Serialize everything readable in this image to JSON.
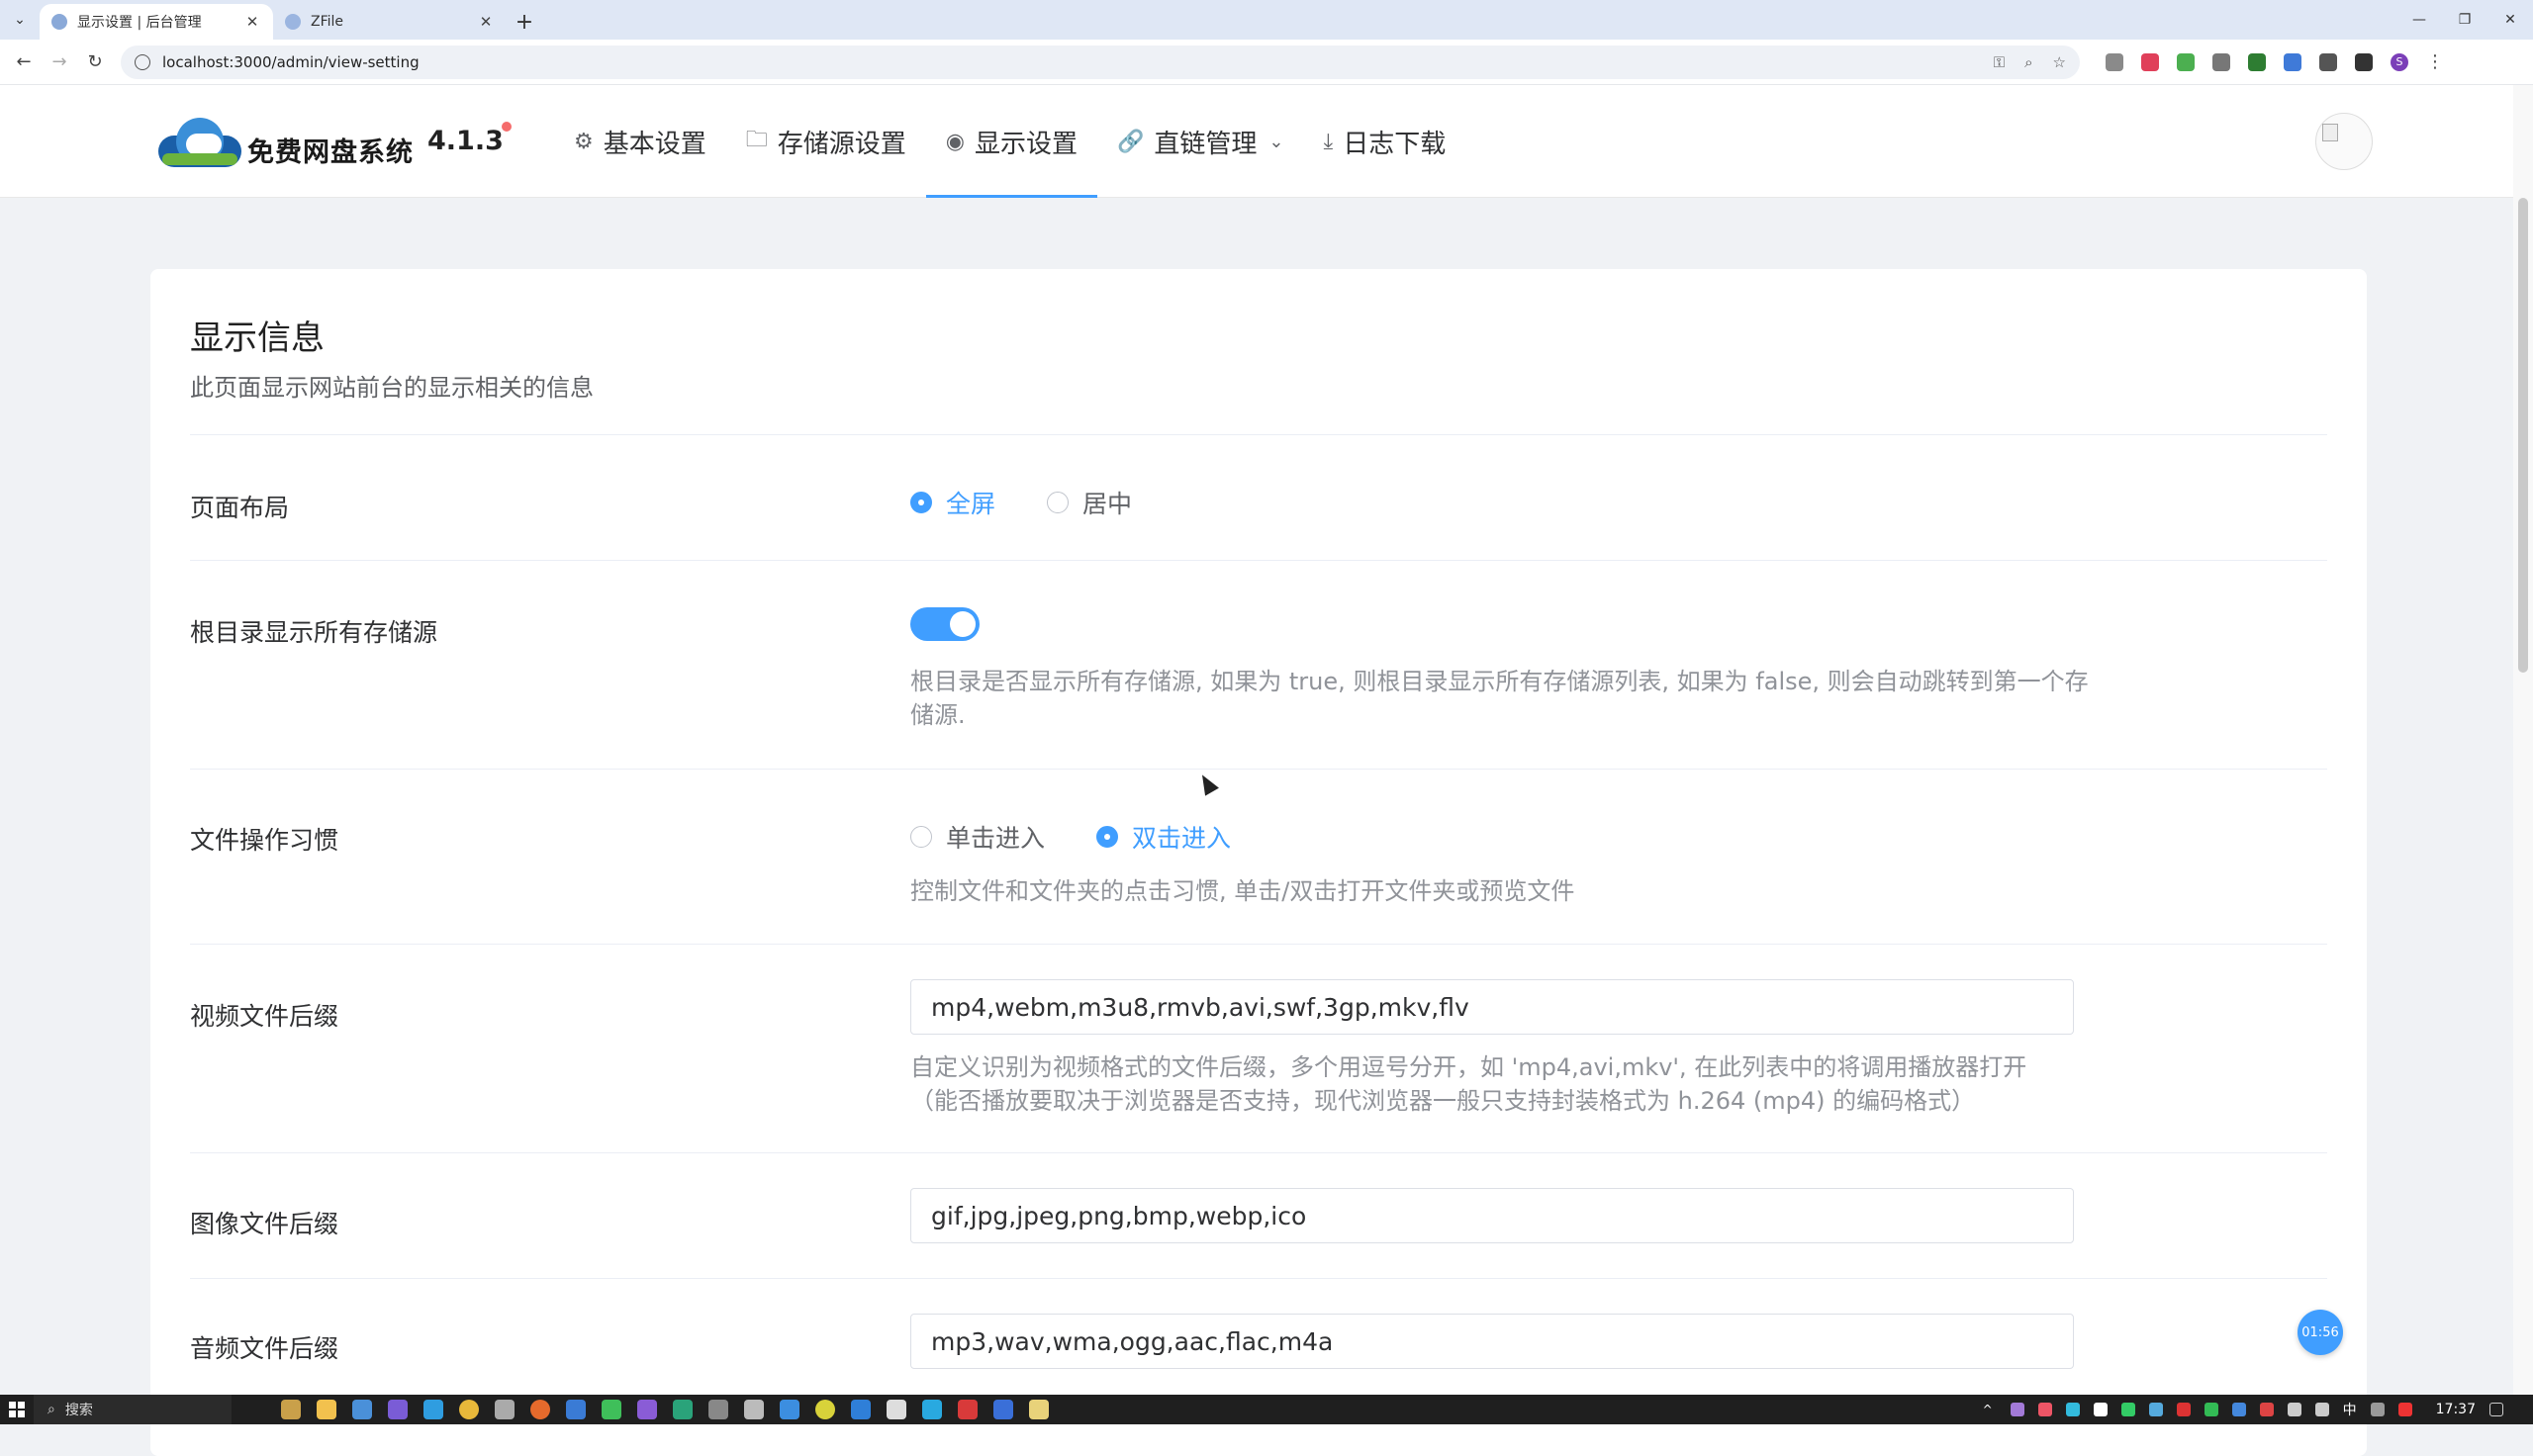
{
  "browser": {
    "tabs": [
      {
        "title": "显示设置 | 后台管理",
        "active": true
      },
      {
        "title": "ZFile",
        "active": false
      }
    ],
    "url": "localhost:3000/admin/view-setting"
  },
  "header": {
    "logo_text": "免费网盘系统",
    "version": "4.1.3",
    "menu": [
      {
        "label": "基本设置",
        "icon": "gear-icon"
      },
      {
        "label": "存储源设置",
        "icon": "folder-icon"
      },
      {
        "label": "显示设置",
        "icon": "eye-icon",
        "active": true
      },
      {
        "label": "直链管理",
        "icon": "link-icon",
        "dropdown": true
      },
      {
        "label": "日志下载",
        "icon": "download-icon"
      }
    ]
  },
  "card": {
    "title": "显示信息",
    "subtitle": "此页面显示网站前台的显示相关的信息",
    "layout": {
      "label": "页面布局",
      "options": [
        "全屏",
        "居中"
      ],
      "selected": "全屏"
    },
    "root_show": {
      "label": "根目录显示所有存储源",
      "enabled": true,
      "help": "根目录是否显示所有存储源, 如果为 true, 则根目录显示所有存储源列表, 如果为 false, 则会自动跳转到第一个存储源."
    },
    "file_habit": {
      "label": "文件操作习惯",
      "options": [
        "单击进入",
        "双击进入"
      ],
      "selected": "双击进入",
      "help": "控制文件和文件夹的点击习惯, 单击/双击打开文件夹或预览文件"
    },
    "video_ext": {
      "label": "视频文件后缀",
      "value": "mp4,webm,m3u8,rmvb,avi,swf,3gp,mkv,flv",
      "help_1": "自定义识别为视频格式的文件后缀，多个用逗号分开，如 'mp4,avi,mkv', 在此列表中的将调用播放器打开",
      "help_2": "（能否播放要取决于浏览器是否支持，现代浏览器一般只支持封装格式为 h.264 (mp4) 的编码格式）"
    },
    "image_ext": {
      "label": "图像文件后缀",
      "value": "gif,jpg,jpeg,png,bmp,webp,ico"
    },
    "audio_ext": {
      "label": "音频文件后缀",
      "value": "mp3,wav,wma,ogg,aac,flac,m4a"
    }
  },
  "timer": "01:56",
  "taskbar": {
    "search_label": "搜索",
    "time": "17:37",
    "ime": "中"
  },
  "colors": {
    "accent": "#409eff",
    "text_primary": "#303133",
    "text_help": "#909399"
  }
}
